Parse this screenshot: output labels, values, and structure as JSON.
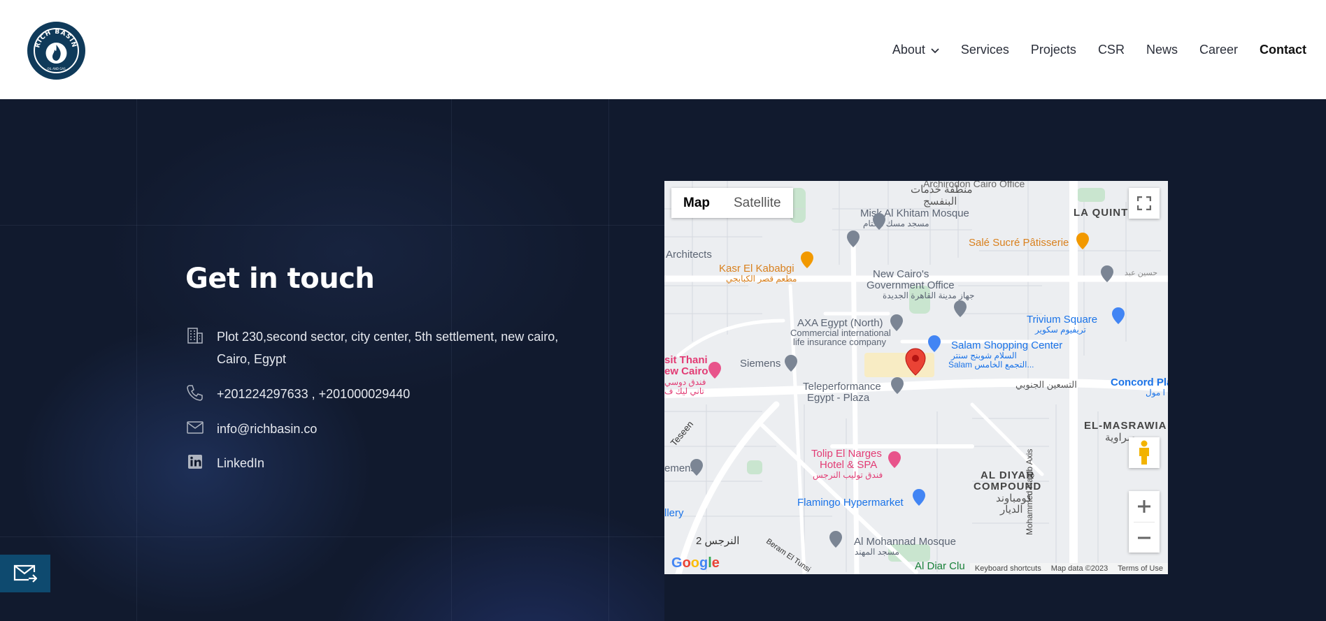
{
  "header": {
    "logo_top_text": "RICH BASIN",
    "logo_bottom_text": "OIL AND GAS",
    "nav": [
      {
        "label": "About",
        "has_dropdown": true
      },
      {
        "label": "Services"
      },
      {
        "label": "Projects"
      },
      {
        "label": "CSR"
      },
      {
        "label": "News"
      },
      {
        "label": "Career"
      },
      {
        "label": "Contact",
        "active": true
      }
    ]
  },
  "contact": {
    "title": "Get in touch",
    "address_line1": "Plot 230,second sector, city center, 5th settlement, new cairo,",
    "address_line2": "Cairo, Egypt",
    "phone": "+201224297633 , +201000029440",
    "email": "info@richbasin.co",
    "linkedin": "LinkedIn"
  },
  "map": {
    "toggle_map": "Map",
    "toggle_satellite": "Satellite",
    "labels": {
      "archirodon": "Archirodon Cairo Office",
      "services_area_ar": "منطقة خدمات",
      "violet_ar": "البنفسج",
      "la_quinta": "LA QUINT",
      "misk": "Misk Al Khitam Mosque",
      "misk_ar": "مسجد مسك الختام",
      "architects": "Architects",
      "sale_sucre": "Salé Sucré Pâtisserie",
      "kasr": "Kasr El Kababgi",
      "kasr_ar": "مطعم قصر الكبابجي",
      "gov_office1": "New Cairo's",
      "gov_office2": "Government Office",
      "gov_office_ar": "جهاز مدينة القاهرة الجديدة",
      "hussein_ar": "حسين عبد",
      "axa1": "AXA Egypt (North)",
      "axa2": "Commercial international",
      "axa3": "life insurance company",
      "trivium": "Trivium Square",
      "trivium_ar": "تريفيوم سكوير",
      "salam": "Salam Shopping Center",
      "salam_ar1": "السلام شوبنج سنتر",
      "salam_ar2": "Salam التجمع الخامس...",
      "siemens": "Siemens",
      "thani1": "sit Thani",
      "thani2": "ew Cairo",
      "thani_ar1": "فندق دوسي",
      "thani_ar2": "تاني ليك ف",
      "teleperformance1": "Teleperformance",
      "teleperformance2": "Egypt - Plaza",
      "south90_ar": "التسعين الجنوبي",
      "concord": "Concord Pla",
      "concord_ar": "ا مول",
      "teseen": "Teseen",
      "masrawia": "EL-MASRAWIA",
      "masrawia_ar": "صراوية",
      "tolip1": "Tolip El Narges",
      "tolip2": "Hotel & SPA",
      "tolip_ar": "فندق توليب النرجس",
      "emens": "emens",
      "aldiyar1": "AL DIYAR",
      "aldiyar2": "COMPOUND",
      "aldiyar_ar1": "كومباوند",
      "aldiyar_ar2": "الديار",
      "naguib": "Mohammed Nagib Axis",
      "flamingo": "Flamingo Hypermarket",
      "llery": "llery",
      "narges2": "2  النرجس",
      "beram": "Beram El Tunsi",
      "mohannad": "Al Mohannad Mosque",
      "mohannad_ar": "مسجد المهند",
      "aldiar_club": "Al Diar Clu"
    },
    "attribution": {
      "keyboard": "Keyboard shortcuts",
      "data": "Map data ©2023",
      "terms": "Terms of Use"
    },
    "google": "Google"
  }
}
